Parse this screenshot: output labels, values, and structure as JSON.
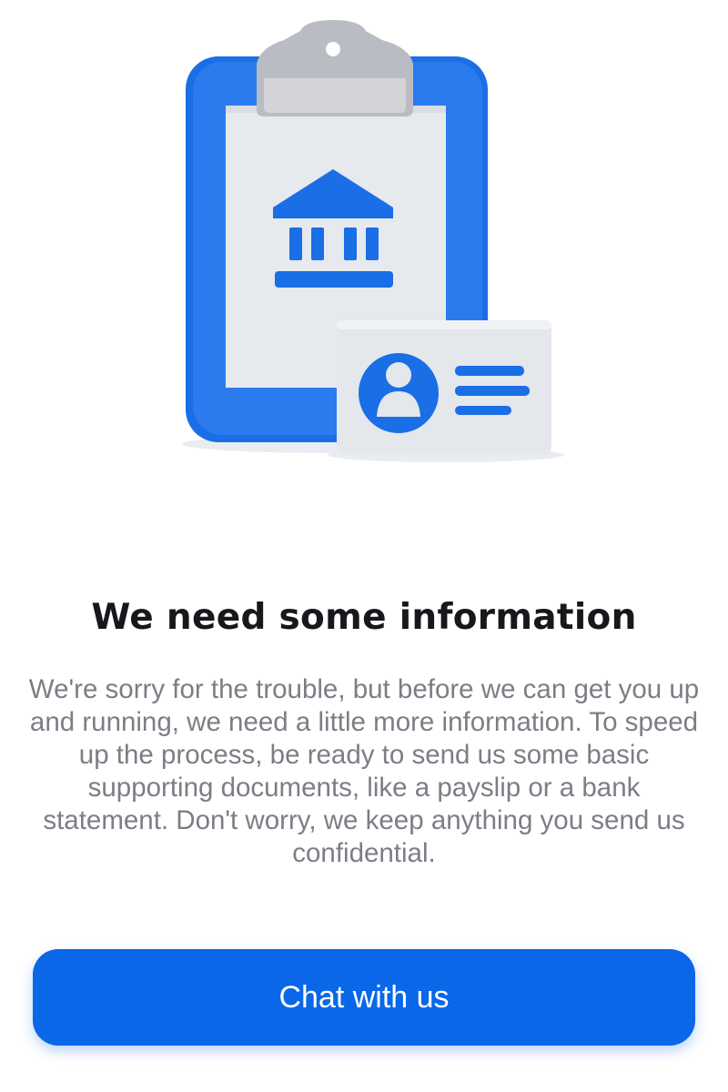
{
  "illustration": {
    "description_icon": "clipboard-bank-id-card-illustration",
    "accent_color": "#1a6ee6"
  },
  "content": {
    "title": "We need some information",
    "body": "We're sorry for the trouble, but before we can get you up and running, we need a little more information. To speed up the process, be ready to send us some basic supporting documents, like a payslip or a bank statement. Don't worry, we keep anything you send us confidential."
  },
  "actions": {
    "chat_button_label": "Chat with us",
    "chat_button_color": "#0a67e8"
  }
}
